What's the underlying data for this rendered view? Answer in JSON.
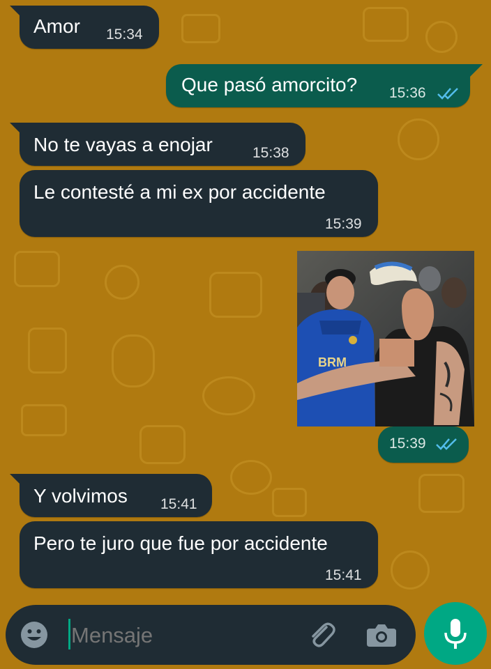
{
  "messages": [
    {
      "text": "Amor",
      "time": "15:34"
    },
    {
      "text": "Que pasó amorcito?",
      "time": "15:36"
    },
    {
      "text": "No te vayas a enojar",
      "time": "15:38"
    },
    {
      "text": "Le contesté a mi ex por accidente",
      "time": "15:39"
    },
    {
      "image_time": "15:39"
    },
    {
      "text": "Y volvimos",
      "time": "15:41"
    },
    {
      "text": "Pero te juro que fue por accidente",
      "time": "15:41"
    }
  ],
  "photo_print": "BRM",
  "input": {
    "placeholder": "Mensaje"
  },
  "colors": {
    "wallpaper": "#b07a10",
    "incoming_bubble": "#1f2c34",
    "outgoing_bubble": "#0b5c4d",
    "read_ticks": "#53bdeb",
    "accent": "#00a884"
  },
  "icons": [
    "emoji-icon",
    "attach-icon",
    "camera-icon",
    "mic-icon",
    "double-check-icon"
  ]
}
